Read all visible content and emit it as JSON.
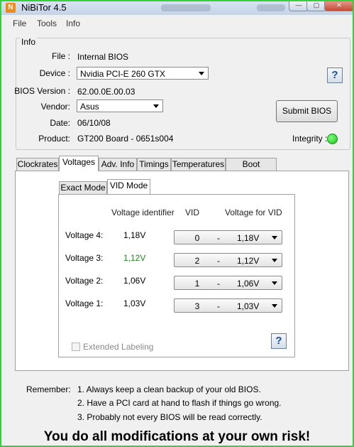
{
  "window": {
    "title": "NiBiTor 4.5",
    "app_icon_glyph": "N",
    "controls": {
      "minimize": "—",
      "maximize": "▢",
      "close": "✕"
    }
  },
  "menu": {
    "items": [
      "File",
      "Tools",
      "Info"
    ]
  },
  "info": {
    "legend": "Info",
    "file_label": "File :",
    "file_value": "Internal BIOS",
    "device_label": "Device :",
    "device_value": "Nvidia PCI-E 260 GTX",
    "bios_version_label": "BIOS Version :",
    "bios_version_value": "62.00.0E.00.03",
    "vendor_label": "Vendor:",
    "vendor_value": "Asus",
    "date_label": "Date:",
    "date_value": "06/10/08",
    "product_label": "Product:",
    "product_value": "GT200 Board - 0651s004",
    "help_glyph": "?",
    "submit_label": "Submit BIOS",
    "integrity_label": "Integrity :",
    "integrity_color": "#19c219"
  },
  "tabs": [
    "Clockrates",
    "Voltages",
    "Adv. Info",
    "Timings",
    "Temperatures",
    "Boot Settings"
  ],
  "active_tab": "Voltages",
  "voltages": {
    "subtabs": [
      "Exact Mode",
      "VID Mode"
    ],
    "active_subtab": "VID Mode",
    "headers": {
      "identifier": "Voltage identifier",
      "vid": "VID",
      "for_vid": "Voltage for VID"
    },
    "rows": [
      {
        "label": "Voltage 4:",
        "value": "1,18V",
        "vid": "0",
        "sep": "-",
        "vid_voltage": "1,18V",
        "color": "#000000"
      },
      {
        "label": "Voltage 3:",
        "value": "1,12V",
        "vid": "2",
        "sep": "-",
        "vid_voltage": "1,12V",
        "color": "#1f8a1f"
      },
      {
        "label": "Voltage 2:",
        "value": "1,06V",
        "vid": "1",
        "sep": "-",
        "vid_voltage": "1,06V",
        "color": "#000000"
      },
      {
        "label": "Voltage 1:",
        "value": "1,03V",
        "vid": "3",
        "sep": "-",
        "vid_voltage": "1,03V",
        "color": "#000000"
      }
    ],
    "extended_labeling": {
      "label": "Extended Labeling",
      "checked": false,
      "enabled": false
    },
    "help_glyph": "?"
  },
  "remember": {
    "label": "Remember:",
    "lines": [
      "1. Always keep a clean backup of your old BIOS.",
      "2. Have a PCI card at hand to flash if things go wrong.",
      "3. Probably not every BIOS will be read correctly."
    ]
  },
  "warning": "You do all modifications at your own risk!"
}
